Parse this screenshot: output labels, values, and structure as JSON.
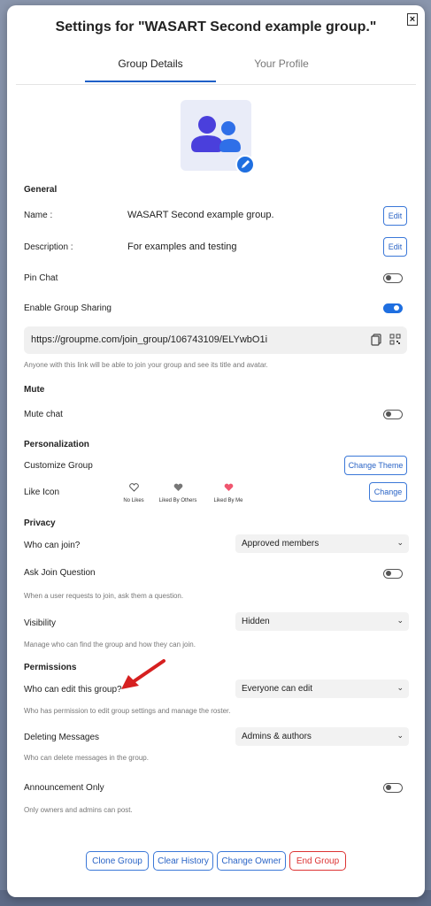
{
  "modal": {
    "title": "Settings for \"WASART Second example group.\"",
    "close_label": "×"
  },
  "tabs": [
    {
      "label": "Group Details",
      "active": true
    },
    {
      "label": "Your Profile",
      "active": false
    }
  ],
  "general": {
    "heading": "General",
    "name_label": "Name :",
    "name_value": "WASART Second example group.",
    "description_label": "Description :",
    "description_value": "For examples and testing",
    "edit_label": "Edit",
    "pin_chat_label": "Pin Chat",
    "pin_chat_on": false,
    "sharing_label": "Enable Group Sharing",
    "sharing_on": true,
    "share_link": "https://groupme.com/join_group/106743109/ELYwbO1i",
    "share_hint": "Anyone with this link will be able to join your group and see its title and avatar."
  },
  "mute": {
    "heading": "Mute",
    "mute_chat_label": "Mute chat",
    "mute_chat_on": false
  },
  "personalization": {
    "heading": "Personalization",
    "customize_label": "Customize Group",
    "change_theme_label": "Change Theme",
    "like_icon_label": "Like Icon",
    "change_label": "Change",
    "like_options": [
      {
        "label": "No Likes",
        "icon": "heart-outline-icon"
      },
      {
        "label": "Liked By Others",
        "icon": "heart-gray-icon"
      },
      {
        "label": "Liked By Me",
        "icon": "heart-pink-icon"
      }
    ]
  },
  "privacy": {
    "heading": "Privacy",
    "who_can_join_label": "Who can join?",
    "who_can_join_value": "Approved members",
    "ask_question_label": "Ask Join Question",
    "ask_question_on": false,
    "ask_question_hint": "When a user requests to join, ask them a question.",
    "visibility_label": "Visibility",
    "visibility_value": "Hidden",
    "visibility_hint": "Manage who can find the group and how they can join."
  },
  "permissions": {
    "heading": "Permissions",
    "who_can_edit_label": "Who can edit this group?",
    "who_can_edit_value": "Everyone can edit",
    "who_can_edit_hint": "Who has permission to edit group settings and manage the roster.",
    "deleting_label": "Deleting Messages",
    "deleting_value": "Admins & authors",
    "deleting_hint": "Who can delete messages in the group.",
    "announcement_label": "Announcement Only",
    "announcement_on": false,
    "announcement_hint": "Only owners and admins can post."
  },
  "footer": {
    "clone_label": "Clone Group",
    "clear_label": "Clear History",
    "change_owner_label": "Change Owner",
    "end_label": "End Group"
  },
  "colors": {
    "accent": "#1f6fe0",
    "danger": "#d33333",
    "annotation_arrow": "#d62020"
  }
}
